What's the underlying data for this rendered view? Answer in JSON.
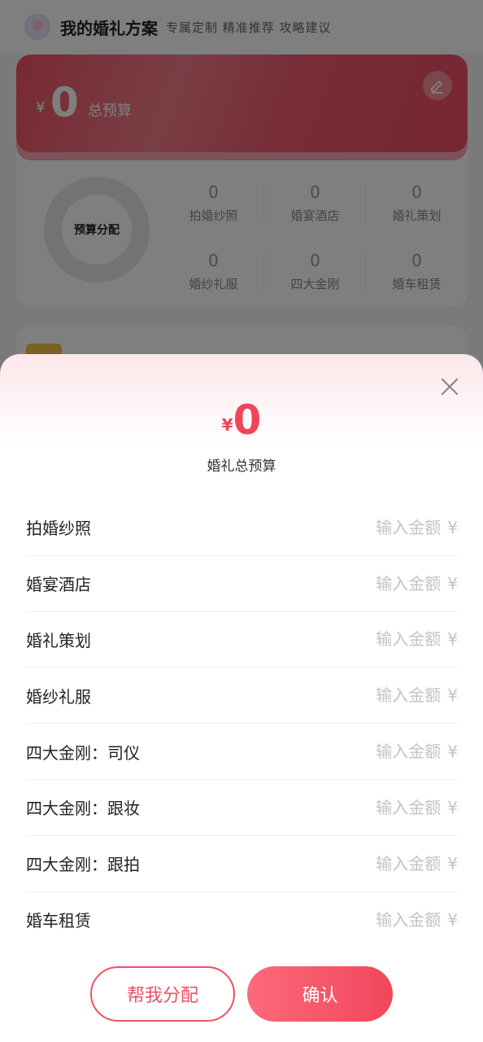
{
  "header": {
    "title": "我的婚礼方案",
    "subtitle": "专属定制 精准推荐 攻略建议",
    "logo_icon": "wedding-logo-icon"
  },
  "budget_card": {
    "currency": "¥",
    "amount": "0",
    "label": "总预算",
    "edit_icon": "pencil-icon",
    "donut_label": "预算分配",
    "categories": [
      {
        "value": "0",
        "name": "拍婚纱照"
      },
      {
        "value": "0",
        "name": "婚宴酒店"
      },
      {
        "value": "0",
        "name": "婚礼策划"
      },
      {
        "value": "0",
        "name": "婚纱礼服"
      },
      {
        "value": "0",
        "name": "四大金刚"
      },
      {
        "value": "0",
        "name": "婚车租赁"
      }
    ]
  },
  "sheet": {
    "close_icon": "close-icon",
    "currency": "¥",
    "total": "0",
    "total_label": "婚礼总预算",
    "placeholder": "输入金额",
    "input_currency": "¥",
    "items": [
      {
        "label": "拍婚纱照",
        "value": ""
      },
      {
        "label": "婚宴酒店",
        "value": ""
      },
      {
        "label": "婚礼策划",
        "value": ""
      },
      {
        "label": "婚纱礼服",
        "value": ""
      },
      {
        "label": "四大金刚：司仪",
        "value": ""
      },
      {
        "label": "四大金刚：跟妆",
        "value": ""
      },
      {
        "label": "四大金刚：跟拍",
        "value": ""
      },
      {
        "label": "婚车租赁",
        "value": ""
      }
    ],
    "auto_button": "帮我分配",
    "confirm_button": "确认"
  },
  "colors": {
    "accent": "#f0455a",
    "card_red": "#ef5365"
  }
}
